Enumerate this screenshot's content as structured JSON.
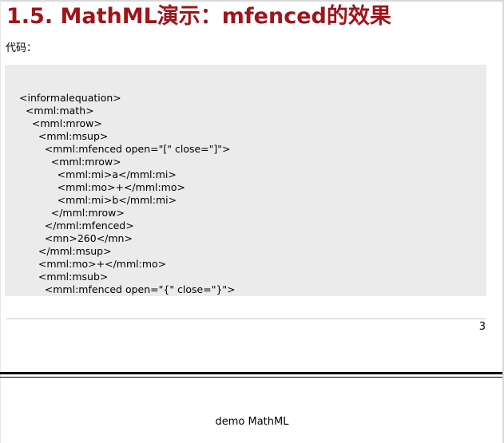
{
  "section": {
    "title": "1.5. MathML演示：mfenced的效果",
    "code_label": "代码："
  },
  "code": {
    "lines": [
      "<informalequation>",
      "  <mml:math>",
      "    <mml:mrow>",
      "      <mml:msup>",
      "        <mml:mfenced open=\"[\" close=\"]\">",
      "          <mml:mrow>",
      "            <mml:mi>a</mml:mi>",
      "            <mml:mo>+</mml:mo>",
      "            <mml:mi>b</mml:mi>",
      "          </mml:mrow>",
      "        </mml:mfenced>",
      "        <mn>260</mn>",
      "      </mml:msup>",
      "      <mml:mo>+</mml:mo>",
      "      <mml:msub>",
      "        <mml:mfenced open=\"{\" close=\"}\">"
    ]
  },
  "page": {
    "number": "3",
    "footer": "demo MathML"
  }
}
